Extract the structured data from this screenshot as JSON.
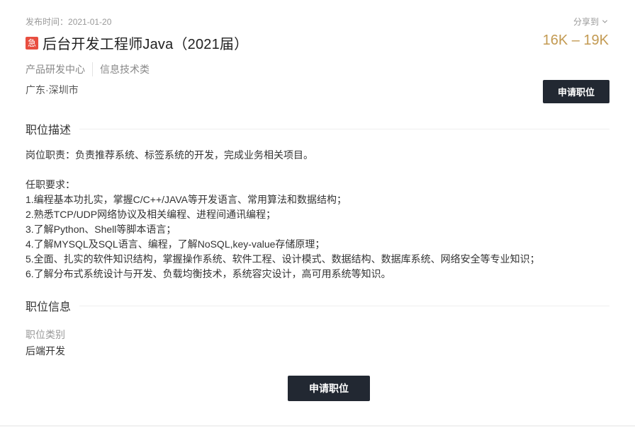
{
  "job": {
    "publish_label": "发布时间：",
    "publish_date": "2021-01-20",
    "share_label": "分享到",
    "urgent_badge": "急",
    "title": "后台开发工程师Java（2021届）",
    "salary": "16K – 19K",
    "department": "产品研发中心",
    "category": "信息技术类",
    "location": "广东·深圳市",
    "apply_label": "申请职位"
  },
  "sections": {
    "description_title": "职位描述",
    "info_title": "职位信息"
  },
  "description": {
    "duty": "岗位职责：负责推荐系统、标签系统的开发，完成业务相关项目。",
    "requirements_title": "任职要求：",
    "requirements": [
      "1.编程基本功扎实，掌握C/C++/JAVA等开发语言、常用算法和数据结构；",
      "2.熟悉TCP/UDP网络协议及相关编程、进程间通讯编程；",
      "3.了解Python、Shell等脚本语言；",
      "4.了解MYSQL及SQL语言、编程，了解NoSQL,key-value存储原理；",
      "5.全面、扎实的软件知识结构，掌握操作系统、软件工程、设计模式、数据结构、数据库系统、网络安全等专业知识；",
      "6.了解分布式系统设计与开发、负载均衡技术，系统容灾设计，高可用系统等知识。"
    ]
  },
  "info": {
    "type_label": "职位类别",
    "type_value": "后端开发"
  },
  "colors": {
    "salary": "#c39a52",
    "urgent": "#e84e40",
    "button_bg": "#222832"
  }
}
